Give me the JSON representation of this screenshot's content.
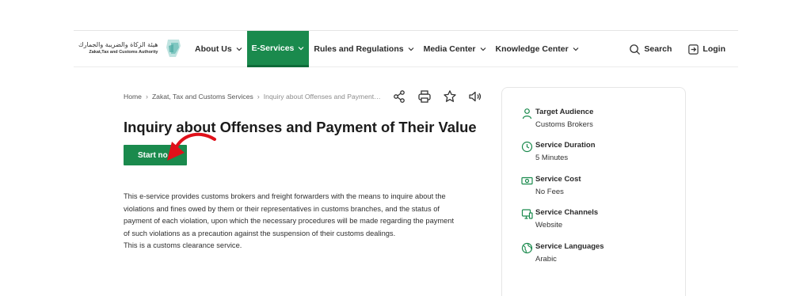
{
  "logo": {
    "arabic": "هيئة الزكاة والضريبة والجمارك",
    "english": "Zakat,Tax and Customs Authority"
  },
  "nav": {
    "items": [
      {
        "label": "About Us"
      },
      {
        "label": "E-Services"
      },
      {
        "label": "Rules and Regulations"
      },
      {
        "label": "Media Center"
      },
      {
        "label": "Knowledge Center"
      }
    ],
    "search_label": "Search",
    "login_label": "Login"
  },
  "breadcrumb": {
    "home": "Home",
    "level1": "Zakat, Tax and Customs Services",
    "current": "Inquiry about Offenses and Payment of Their Value"
  },
  "page": {
    "title": "Inquiry about Offenses and Payment of Their Value",
    "start_button": "Start no",
    "description": [
      "This e-service provides customs brokers and freight forwarders with the means to inquire about the",
      "violations and fines owed by them or their representatives in customs branches, and the status of",
      "payment of each violation, upon which the necessary procedures will be made regarding the payment",
      "of such violations as a precaution against the suspension of their customs dealings.",
      "This is a customs clearance service."
    ]
  },
  "service_info": [
    {
      "label": "Target Audience",
      "value": "Customs Brokers",
      "icon": "person-icon"
    },
    {
      "label": "Service Duration",
      "value": "5 Minutes",
      "icon": "clock-icon"
    },
    {
      "label": "Service Cost",
      "value": "No Fees",
      "icon": "money-icon"
    },
    {
      "label": "Service Channels",
      "value": "Website",
      "icon": "monitor-icon"
    },
    {
      "label": "Service Languages",
      "value": "Arabic",
      "icon": "globe-icon"
    }
  ],
  "colors": {
    "brand_green": "#1a8a4d",
    "annotation_red": "#e0101a"
  }
}
